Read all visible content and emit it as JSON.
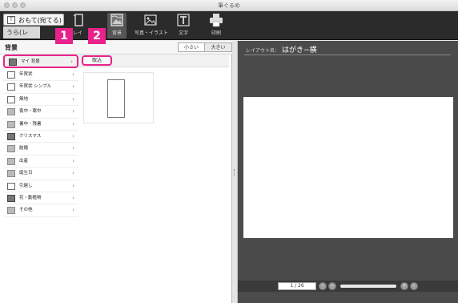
{
  "window": {
    "title": "筆ぐるめ"
  },
  "toolbar": {
    "front_side": "おもて(宛てる)",
    "back_side": "うら(レ",
    "tools": [
      {
        "label": "レイ",
        "icon": "layout-icon"
      },
      {
        "label": "背景",
        "icon": "background-icon"
      },
      {
        "label": "写真・イラスト",
        "icon": "photo-illustration-icon"
      },
      {
        "label": "文字",
        "icon": "text-icon"
      },
      {
        "label": "印刷",
        "icon": "printer-icon"
      }
    ],
    "active_tool": "背景"
  },
  "left_pane": {
    "title": "背景",
    "size_small": "小さい",
    "size_large": "大きい",
    "categories": [
      {
        "label": "マイ 背景",
        "icon": "my-background-icon",
        "selected": true
      },
      {
        "label": "年賀状",
        "icon": "newyear-card-icon"
      },
      {
        "label": "年賀状 シンプル",
        "icon": "newyear-simple-icon"
      },
      {
        "label": "無地",
        "icon": "plain-icon"
      },
      {
        "label": "喪中・寒中",
        "icon": "mourning-icon"
      },
      {
        "label": "暑中・残暑",
        "icon": "summer-greeting-icon"
      },
      {
        "label": "クリスマス",
        "icon": "christmas-icon"
      },
      {
        "label": "結婚",
        "icon": "wedding-icon"
      },
      {
        "label": "出産",
        "icon": "birth-icon"
      },
      {
        "label": "誕生日",
        "icon": "birthday-icon"
      },
      {
        "label": "引越し",
        "icon": "moving-icon"
      },
      {
        "label": "花・動植物",
        "icon": "flower-icon"
      },
      {
        "label": "その他",
        "icon": "other-icon"
      }
    ],
    "import_button": "取込"
  },
  "callouts": {
    "step1": "1",
    "step2": "2"
  },
  "right_pane": {
    "layout_name_label": "レイアウト名：",
    "layout_name_value": "はがき−横",
    "page_indicator": "1 / 26"
  },
  "colors": {
    "highlight": "#e8228a",
    "toolbar_bg": "#2b2b2b",
    "preview_bg": "#4b4b4b"
  }
}
